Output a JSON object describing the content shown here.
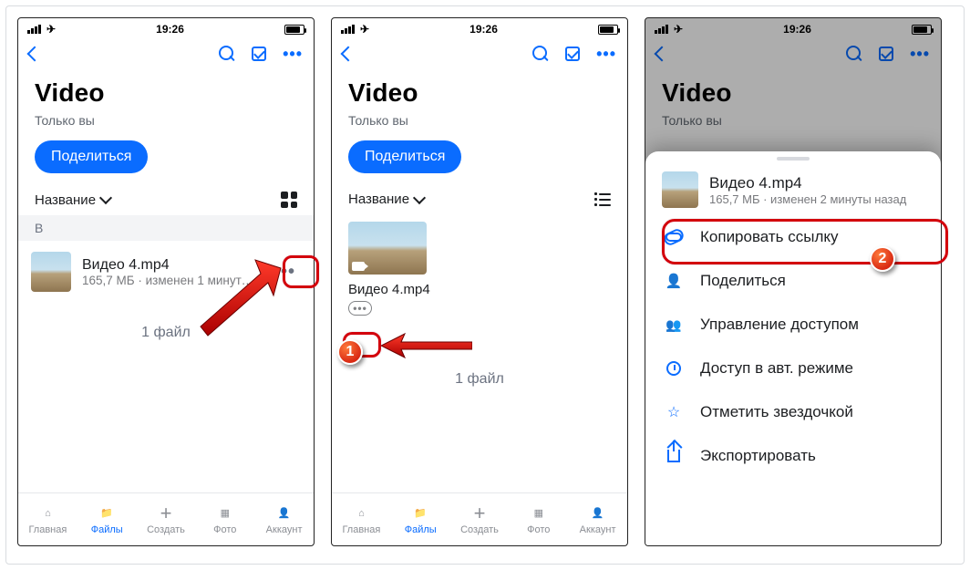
{
  "status": {
    "time": "19:26"
  },
  "header": {
    "folder_title": "Video",
    "subtitle": "Только вы",
    "share_button": "Поделиться"
  },
  "sort": {
    "label": "Название"
  },
  "section_letter": "В",
  "file": {
    "name": "Видео 4.mp4",
    "meta_list": "165,7 МБ · изменен 1 минута на..",
    "meta_sheet": "165,7 МБ · изменен 2 минуты назад",
    "grid_name": "Видео 4.mp4"
  },
  "count": "1 файл",
  "tabs": {
    "home": "Главная",
    "files": "Файлы",
    "create": "Создать",
    "photo": "Фото",
    "account": "Аккаунт"
  },
  "sheet_menu": {
    "copy_link": "Копировать ссылку",
    "share": "Поделиться",
    "manage_access": "Управление доступом",
    "offline": "Доступ в авт. режиме",
    "star": "Отметить звездочкой",
    "export": "Экспортировать"
  },
  "callouts": {
    "one": "1",
    "two": "2"
  }
}
